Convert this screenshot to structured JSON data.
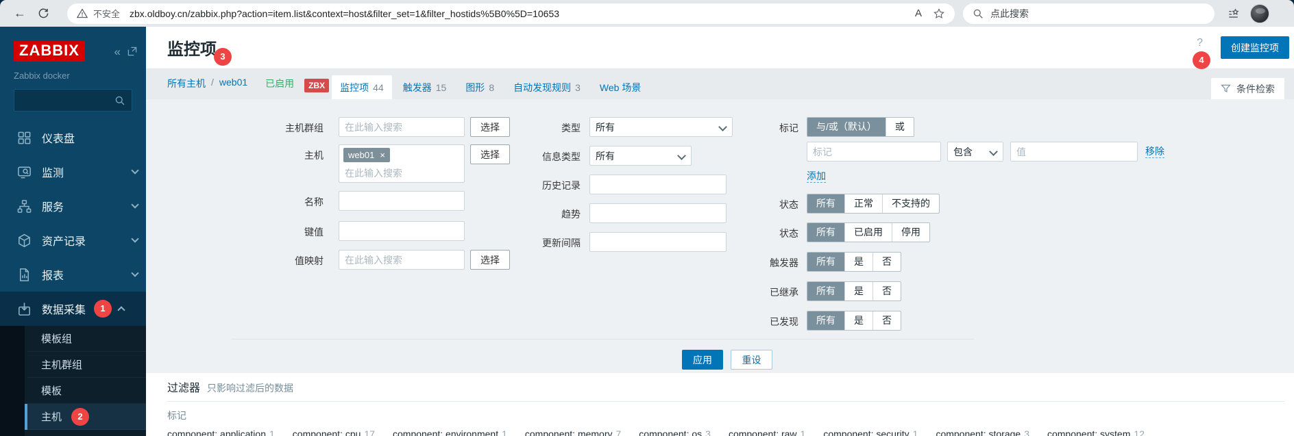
{
  "browser": {
    "back_icon": "←",
    "security_label": "不安全",
    "url": "zbx.oldboy.cn/zabbix.php?action=item.list&context=host&filter_set=1&filter_hostids%5B0%5D=10653",
    "read_aloud_icon": "A",
    "search_placeholder": "点此搜索"
  },
  "sidebar": {
    "logo": "ZABBIX",
    "collapse_icon": "«",
    "subtitle": "Zabbix docker",
    "items": [
      {
        "label": "仪表盘"
      },
      {
        "label": "监测"
      },
      {
        "label": "服务"
      },
      {
        "label": "资产记录"
      },
      {
        "label": "报表"
      },
      {
        "label": "数据采集",
        "badge": "1"
      }
    ],
    "submenu": [
      {
        "label": "模板组"
      },
      {
        "label": "主机群组"
      },
      {
        "label": "模板"
      },
      {
        "label": "主机",
        "badge": "2"
      }
    ]
  },
  "header": {
    "title": "监控项",
    "title_badge": "3",
    "help_icon": "?",
    "create_button": "创建监控项",
    "create_badge": "4"
  },
  "breadcrumb": {
    "all_hosts": "所有主机",
    "separator": "/",
    "host": "web01",
    "status": "已启用",
    "zbx_badge": "ZBX"
  },
  "tabs": [
    {
      "label": "监控项",
      "count": "44"
    },
    {
      "label": "触发器",
      "count": "15"
    },
    {
      "label": "图形",
      "count": "8"
    },
    {
      "label": "自动发现规则",
      "count": "3"
    },
    {
      "label": "Web 场景",
      "count": ""
    }
  ],
  "filter_tab": {
    "label": "条件检索"
  },
  "filter": {
    "host_group": {
      "label": "主机群组",
      "placeholder": "在此输入搜索",
      "select": "选择"
    },
    "host": {
      "label": "主机",
      "chip": "web01",
      "close_icon": "×",
      "placeholder": "在此输入搜索",
      "select": "选择"
    },
    "name": {
      "label": "名称"
    },
    "key": {
      "label": "键值"
    },
    "value_map": {
      "label": "值映射",
      "placeholder": "在此输入搜索",
      "select": "选择"
    },
    "type": {
      "label": "类型",
      "value": "所有"
    },
    "info_type": {
      "label": "信息类型",
      "value": "所有"
    },
    "history": {
      "label": "历史记录"
    },
    "trends": {
      "label": "趋势"
    },
    "interval": {
      "label": "更新间隔"
    },
    "tags": {
      "label": "标记",
      "mode_options": [
        "与/或（默认）",
        "或"
      ],
      "tag_placeholder": "标记",
      "operator": "包含",
      "value_placeholder": "值",
      "remove": "移除",
      "add": "添加"
    },
    "state": {
      "label": "状态",
      "options": [
        "所有",
        "正常",
        "不支持的"
      ]
    },
    "status": {
      "label": "状态",
      "options": [
        "所有",
        "已启用",
        "停用"
      ]
    },
    "triggers": {
      "label": "触发器",
      "options": [
        "所有",
        "是",
        "否"
      ]
    },
    "inherited": {
      "label": "已继承",
      "options": [
        "所有",
        "是",
        "否"
      ]
    },
    "discovered": {
      "label": "已发现",
      "options": [
        "所有",
        "是",
        "否"
      ]
    },
    "apply": "应用",
    "reset": "重设"
  },
  "subfilter": {
    "title": "过滤器",
    "note": "只影响过滤后的数据",
    "tags_label": "标记",
    "tags": [
      {
        "name": "component: application",
        "count": "1"
      },
      {
        "name": "component: cpu",
        "count": "17"
      },
      {
        "name": "component: environment",
        "count": "1"
      },
      {
        "name": "component: memory",
        "count": "7"
      },
      {
        "name": "component: os",
        "count": "3"
      },
      {
        "name": "component: raw",
        "count": "1"
      },
      {
        "name": "component: security",
        "count": "1"
      },
      {
        "name": "component: storage",
        "count": "3"
      },
      {
        "name": "component: system",
        "count": "12"
      }
    ]
  },
  "colors": {
    "accent": "#0275b8",
    "enabled_green": "#34af67",
    "badge_red": "#ee4444",
    "zbx_red": "#d64a49",
    "segment_selected": "#7a909c",
    "sidebar_bg": "#0d4566"
  }
}
